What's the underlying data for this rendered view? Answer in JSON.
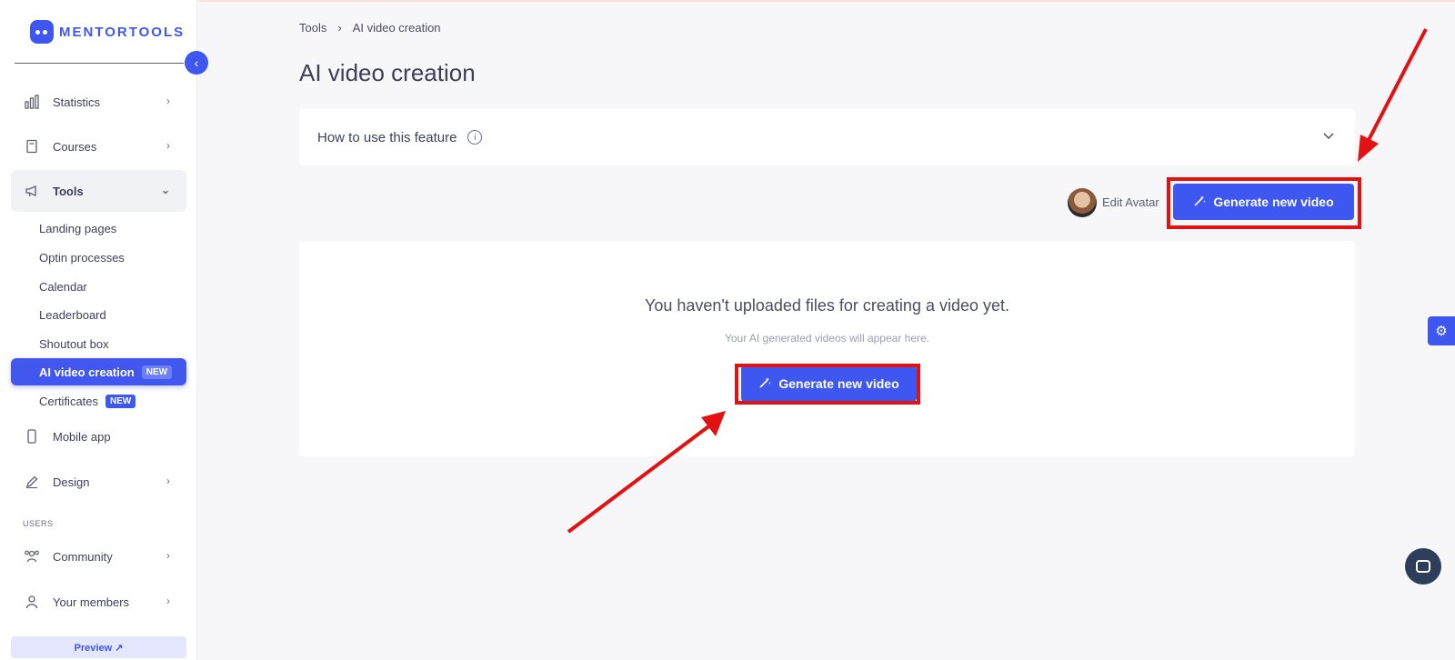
{
  "app": {
    "logo_text": "MENTORTOOLS",
    "brand_color": "#3d57f0",
    "annotation_color": "#e31212"
  },
  "sidebar": {
    "items": [
      {
        "label": "Statistics",
        "icon": "bar-chart-icon"
      },
      {
        "label": "Courses",
        "icon": "book-icon"
      },
      {
        "label": "Tools",
        "icon": "megaphone-icon",
        "expanded": true
      },
      {
        "label": "Mobile app",
        "icon": "phone-icon"
      },
      {
        "label": "Design",
        "icon": "pencil-icon"
      },
      {
        "label": "Community",
        "icon": "users-icon"
      },
      {
        "label": "Your members",
        "icon": "user-icon"
      }
    ],
    "tools_sub": [
      {
        "label": "Landing pages"
      },
      {
        "label": "Optin processes"
      },
      {
        "label": "Calendar"
      },
      {
        "label": "Leaderboard"
      },
      {
        "label": "Shoutout box"
      },
      {
        "label": "AI video creation",
        "badge": "NEW",
        "active": true
      },
      {
        "label": "Certificates",
        "badge": "NEW"
      }
    ],
    "section_users": "USERS",
    "preview_label": "Preview ↗"
  },
  "breadcrumb": {
    "parent": "Tools",
    "current": "AI video creation"
  },
  "page": {
    "title": "AI video creation",
    "howto_label": "How to use this feature",
    "edit_avatar": "Edit Avatar",
    "generate_label": "Generate new video",
    "empty_title": "You haven't uploaded files for creating a video yet.",
    "empty_sub": "Your AI generated videos will appear here."
  }
}
